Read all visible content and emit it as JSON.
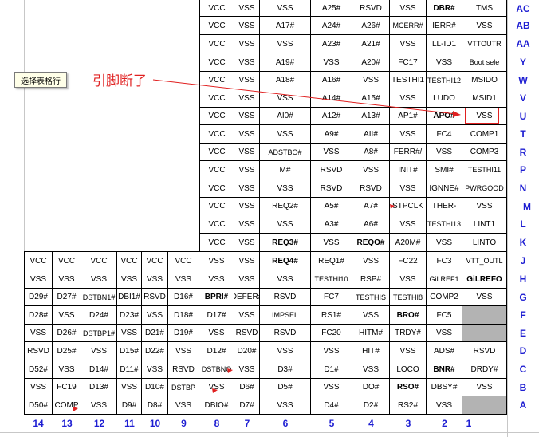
{
  "tooltip_label": "选择表格行",
  "annotation_text": "引脚断了",
  "row_labels": [
    "AC",
    "AB",
    "AA",
    "Y",
    "W",
    "V",
    "U",
    "T",
    "R",
    "P",
    "N",
    "M",
    "L",
    "K",
    "J",
    "H",
    "G",
    "F",
    "E",
    "D",
    "C",
    "B",
    "A"
  ],
  "column_labels": [
    "14",
    "13",
    "12",
    "11",
    "10",
    "9",
    "8",
    "7",
    "6",
    "5",
    "4",
    "3",
    "2",
    "1"
  ],
  "upper_rows": [
    [
      "VCC",
      "VSS",
      "VSS",
      "A25#",
      "RSVD",
      "VSS",
      "DBR#",
      "TMS"
    ],
    [
      "VCC",
      "VSS",
      "A17#",
      "A24#",
      "A26#",
      "MCERR#",
      "IERR#",
      "VSS"
    ],
    [
      "VCC",
      "VSS",
      "VSS",
      "A23#",
      "A21#",
      "VSS",
      "LL-ID1",
      "VTTOUTR"
    ],
    [
      "VCC",
      "VSS",
      "A19#",
      "VSS",
      "A20#",
      "FC17",
      "VSS",
      "Boot sele"
    ],
    [
      "VCC",
      "VSS",
      "A18#",
      "A16#",
      "VSS",
      "TESTHI1",
      "TESTHI12",
      "MSIDO"
    ],
    [
      "VCC",
      "VSS",
      "VSS",
      "A14#",
      "A15#",
      "VSS",
      "LUDO",
      "MSID1"
    ],
    [
      "VCC",
      "VSS",
      "AI0#",
      "A12#",
      "A13#",
      "AP1#",
      "APO#",
      "VSS"
    ],
    [
      "VCC",
      "VSS",
      "VSS",
      "A9#",
      "AII#",
      "VSS",
      "FC4",
      "COMP1"
    ],
    [
      "VCC",
      "VSS",
      "ADSTBO#",
      "VSS",
      "A8#",
      "FERR#/",
      "VSS",
      "COMP3"
    ],
    [
      "VCC",
      "VSS",
      "M#",
      "RSVD",
      "VSS",
      "INIT#",
      "SMI#",
      "TESTHI11"
    ],
    [
      "VCC",
      "VSS",
      "VSS",
      "RSVD",
      "RSVD",
      "VSS",
      "IGNNE#",
      "PWRGOOD"
    ],
    [
      "VCC",
      "VSS",
      "REQ2#",
      "A5#",
      "A7#",
      "STPCLK",
      "THER-",
      "VSS"
    ],
    [
      "VCC",
      "VSS",
      "VSS",
      "A3#",
      "A6#",
      "VSS",
      "TESTHI13",
      "LINT1"
    ],
    [
      "VCC",
      "VSS",
      "REQ3#",
      "VSS",
      "REQO#",
      "A20M#",
      "VSS",
      "LINTO"
    ]
  ],
  "lower_rows": [
    [
      "VCC",
      "VCC",
      "VCC",
      "VCC",
      "VCC",
      "VCC",
      "VSS",
      "VSS",
      "REQ4#",
      "REQ1#",
      "VSS",
      "FC22",
      "FC3",
      "VTT_OUTL"
    ],
    [
      "VSS",
      "VSS",
      "VSS",
      "VSS",
      "VSS",
      "VSS",
      "VSS",
      "VSS",
      "VSS",
      "TESTHI10",
      "RSP#",
      "VSS",
      "GiLREF1",
      "GiLREFO"
    ],
    [
      "D29#",
      "D27#",
      "DSTBN1#",
      "DBI1#",
      "RSVD",
      "D16#",
      "BPRI#",
      "DEFER#",
      "RSVD",
      "FC7",
      "TESTHIS",
      "TESTHI8",
      "COMP2",
      "VSS"
    ],
    [
      "D28#",
      "VSS",
      "D24#",
      "D23#",
      "VSS",
      "D18#",
      "D17#",
      "VSS",
      "IMPSEL",
      "RS1#",
      "VSS",
      "BRO#",
      "FC5",
      ""
    ],
    [
      "VSS",
      "D26#",
      "DSTBP1#",
      "VSS",
      "D21#",
      "D19#",
      "VSS",
      "RSVD",
      "RSVD",
      "FC20",
      "HITM#",
      "TRDY#",
      "VSS",
      ""
    ],
    [
      "RSVD",
      "D25#",
      "VSS",
      "D15#",
      "D22#",
      "VSS",
      "D12#",
      "D20#",
      "VSS",
      "VSS",
      "HIT#",
      "VSS",
      "ADS#",
      "RSVD"
    ],
    [
      "D52#",
      "VSS",
      "D14#",
      "D11#",
      "VSS",
      "RSVD",
      "DSTBNO",
      "VSS",
      "D3#",
      "D1#",
      "VSS",
      "LOCO",
      "BNR#",
      "DRDY#"
    ],
    [
      "VSS",
      "FC19",
      "D13#",
      "VSS",
      "D10#",
      "DSTBP",
      "VSS",
      "D6#",
      "D5#",
      "VSS",
      "DO#",
      "RSO#",
      "DBSY#",
      "VSS"
    ],
    [
      "D50#",
      "COMP",
      "VSS",
      "D9#",
      "D8#",
      "VSS",
      "DBIO#",
      "D7#",
      "VSS",
      "D4#",
      "D2#",
      "RS2#",
      "VSS",
      ""
    ]
  ]
}
